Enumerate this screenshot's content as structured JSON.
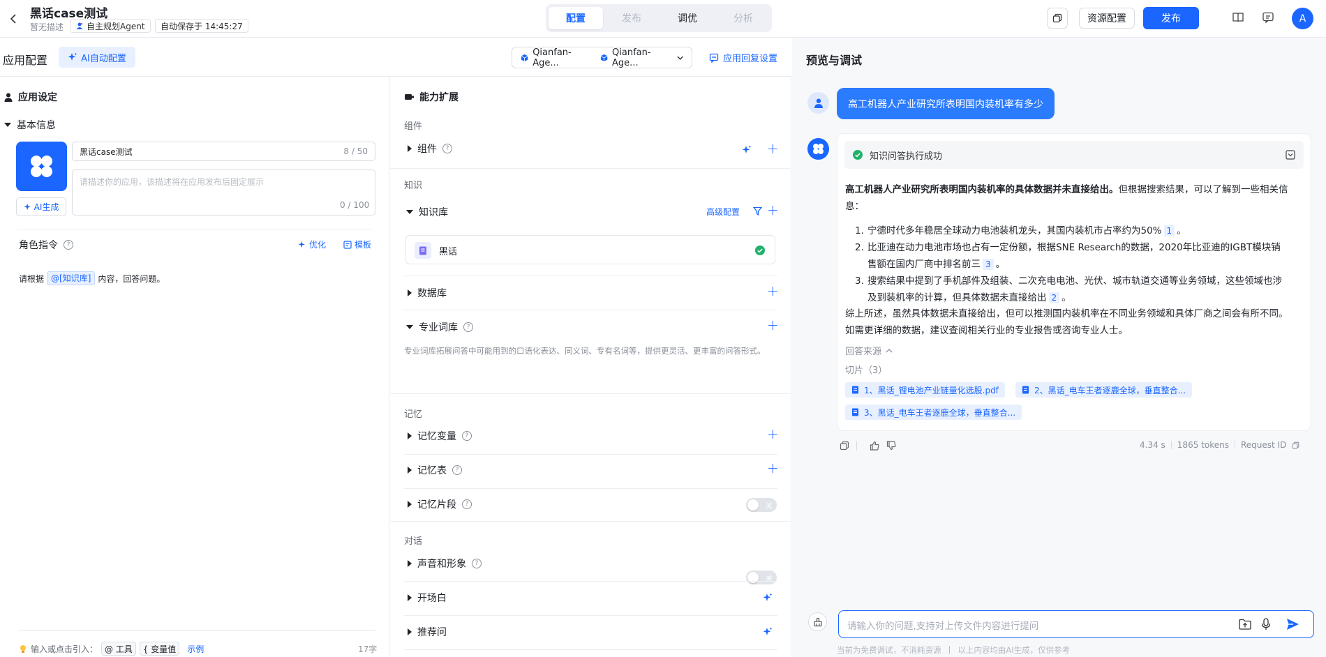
{
  "header": {
    "title": "黑话case测试",
    "desc": "暂无描述",
    "agent_tag": "自主规划Agent",
    "autosave": "自动保存于 14:45:27",
    "tabs": [
      "配置",
      "发布",
      "调优",
      "分析"
    ],
    "resource_btn": "资源配置",
    "publish_btn": "发布",
    "avatar": "A"
  },
  "left_header": {
    "title": "应用配置",
    "ai_config": "AI自动配置",
    "model_a": "Qianfan-Age...",
    "model_b": "Qianfan-Age...",
    "reply_settings": "应用回复设置"
  },
  "settings": {
    "title": "应用设定",
    "basic_info": "基本信息",
    "name_value": "黑话case测试",
    "name_count": "8 / 50",
    "desc_placeholder": "请描述你的应用，该描述将在应用发布后固定展示",
    "desc_count": "0 / 100",
    "ai_gen": "AI生成",
    "role_title": "角色指令",
    "optimize": "优化",
    "template": "模板",
    "instr_pre": "请根据",
    "instr_chip": "@[知识库]",
    "instr_post": "内容，回答问题。",
    "footer_hint": "输入或点击引入：",
    "footer_tool": "@ 工具",
    "footer_var": "{ 变量值",
    "footer_example": "示例",
    "footer_count": "17字"
  },
  "ability": {
    "title": "能力扩展",
    "grp_component": "组件",
    "component": "组件",
    "grp_knowledge": "知识",
    "kb": "知识库",
    "kb_advanced": "高级配置",
    "kb_item": "黑话",
    "database": "数据库",
    "glossary": "专业词库",
    "glossary_desc": "专业词库拓展问答中可能用到的口语化表达、同义词、专有名词等，提供更灵活、更丰富的问答形式。",
    "grp_memory": "记忆",
    "mem_var": "记忆变量",
    "mem_table": "记忆表",
    "mem_frag": "记忆片段",
    "grp_dialog": "对话",
    "voice": "声音和形象",
    "opening": "开场白",
    "recommend": "推荐问",
    "toggle_off": "关"
  },
  "preview": {
    "title": "预览与调试",
    "question": "高工机器人产业研究所表明国内装机率有多少",
    "status": "知识问答执行成功",
    "intro_bold": "高工机器人产业研究所表明国内装机率的具体数据并未直接给出。",
    "intro_rest": "但根据搜索结果，可以了解到一些相关信",
    "intro_rest2": "息：",
    "items": [
      {
        "num": "1.",
        "line1": "宁德时代多年稳居全球动力电池装机龙头，其国内装机市占率约为50%",
        "line2": "",
        "cite": "1"
      },
      {
        "num": "2.",
        "line1": "比亚迪在动力电池市场也占有一定份额，根据SNE Research的数据，2020年比亚迪的IGBT模块销",
        "line2": "售额在国内厂商中排名前三",
        "cite": "3"
      },
      {
        "num": "3.",
        "line1": "搜索结果中提到了手机部件及组装、二次充电电池、光伏、城市轨道交通等业务领域，这些领域也涉",
        "line2": "及到装机率的计算，但具体数据未直接给出",
        "cite": "2"
      }
    ],
    "summary1": "综上所述，虽然具体数据未直接给出，但可以推测国内装机率在不同业务领域和具体厂商之间会有所不同。",
    "summary2": "如需更详细的数据，建议查阅相关行业的专业报告或咨询专业人士。",
    "source_label": "回答来源",
    "slices": "切片（3）",
    "sources": [
      "1、黑话_锂电池产业链量化选股.pdf",
      "2、黑话_电车王者逐鹿全球，垂直整合...",
      "3、黑话_电车王者逐鹿全球，垂直整合..."
    ],
    "time": "4.34 s",
    "tokens": "1865 tokens",
    "request_id": "Request ID",
    "input_placeholder": "请输入你的问题,支持对上传文件内容进行提问",
    "footer_note1": "当前为免费调试，不消耗资源",
    "footer_note2": "以上内容均由AI生成，仅供参考"
  },
  "colors": {
    "accent": "#1a66ff",
    "success": "#20b26b"
  }
}
